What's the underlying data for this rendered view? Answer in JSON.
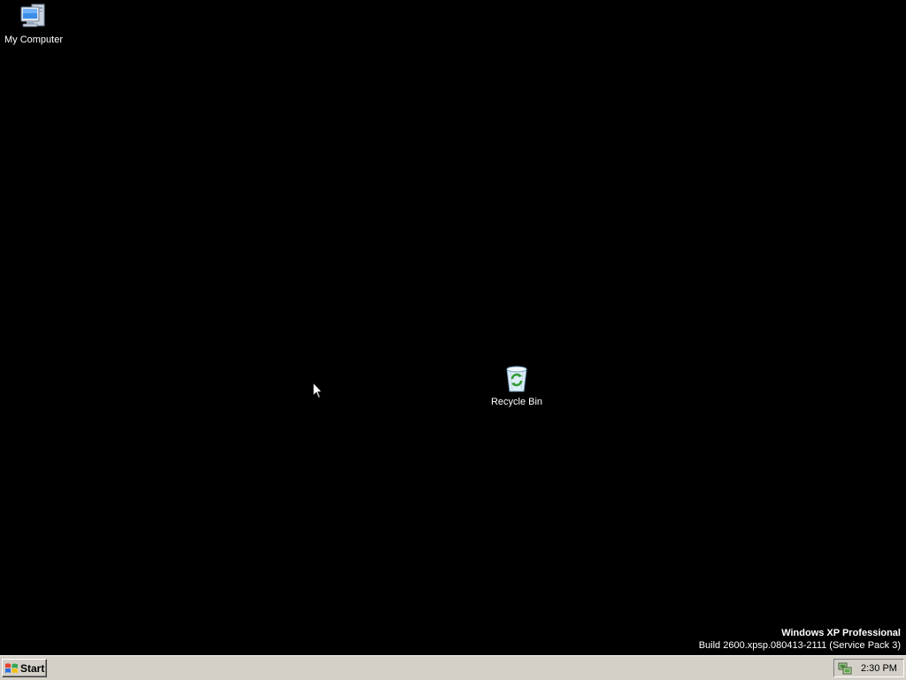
{
  "desktop": {
    "background_color": "#000000",
    "icons": [
      {
        "label": "My Computer",
        "icon": "my-computer-icon"
      },
      {
        "label": "Recycle Bin",
        "icon": "recycle-bin-icon"
      }
    ]
  },
  "watermark": {
    "edition": "Windows XP Professional",
    "build": "Build 2600.xpsp.080413-2111 (Service Pack 3)"
  },
  "taskbar": {
    "start_label": "Start",
    "start_icon": "windows-logo-icon",
    "tray_icon": "network-connection-icon",
    "clock": "2:30 PM",
    "background_color": "#d4d0c8"
  },
  "cursor": {
    "icon": "mouse-pointer-icon"
  }
}
